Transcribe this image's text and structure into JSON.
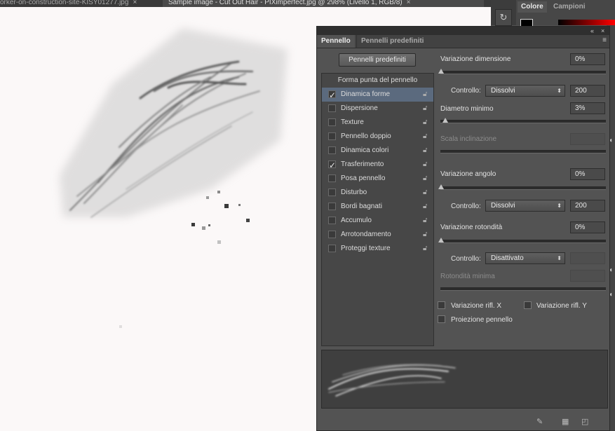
{
  "doc_tabs": [
    {
      "title": "orker-on-construction-site-KISY01277.jpg",
      "close": "×"
    },
    {
      "title": "Sample image - Cut Out Hair - PIXimperfect.jpg @ 298% (Livello 1, RGB/8)",
      "close": "×"
    }
  ],
  "color_panel": {
    "tabs": [
      "Colore",
      "Campioni"
    ]
  },
  "panel": {
    "tabs": [
      "Pennello",
      "Pennelli predefiniti"
    ],
    "predef_button": "Pennelli predefiniti",
    "list_header": "Forma punta del pennello",
    "items": [
      {
        "label": "Dinamica forme",
        "checked": true,
        "selected": true
      },
      {
        "label": "Dispersione",
        "checked": false
      },
      {
        "label": "Texture",
        "checked": false
      },
      {
        "label": "Pennello doppio",
        "checked": false
      },
      {
        "label": "Dinamica colori",
        "checked": false
      },
      {
        "label": "Trasferimento",
        "checked": true
      },
      {
        "label": "Posa pennello",
        "checked": false
      },
      {
        "label": "Disturbo",
        "checked": false
      },
      {
        "label": "Bordi bagnati",
        "checked": false
      },
      {
        "label": "Accumulo",
        "checked": false
      },
      {
        "label": "Arrotondamento",
        "checked": false
      },
      {
        "label": "Proteggi texture",
        "checked": false
      }
    ],
    "settings": {
      "size_jitter_label": "Variazione dimensione",
      "size_jitter_value": "0%",
      "control_label": "Controllo:",
      "control1_value": "Dissolvi",
      "control1_steps": "200",
      "min_diameter_label": "Diametro minimo",
      "min_diameter_value": "3%",
      "tilt_scale_label": "Scala inclinazione",
      "angle_jitter_label": "Variazione angolo",
      "angle_jitter_value": "0%",
      "control2_value": "Dissolvi",
      "control2_steps": "200",
      "roundness_jitter_label": "Variazione rotondità",
      "roundness_jitter_value": "0%",
      "control3_value": "Disattivato",
      "min_roundness_label": "Rotondità minima",
      "flip_x_label": "Variazione rifl. X",
      "flip_y_label": "Variazione rifl. Y",
      "brush_projection_label": "Proiezione pennello"
    }
  }
}
